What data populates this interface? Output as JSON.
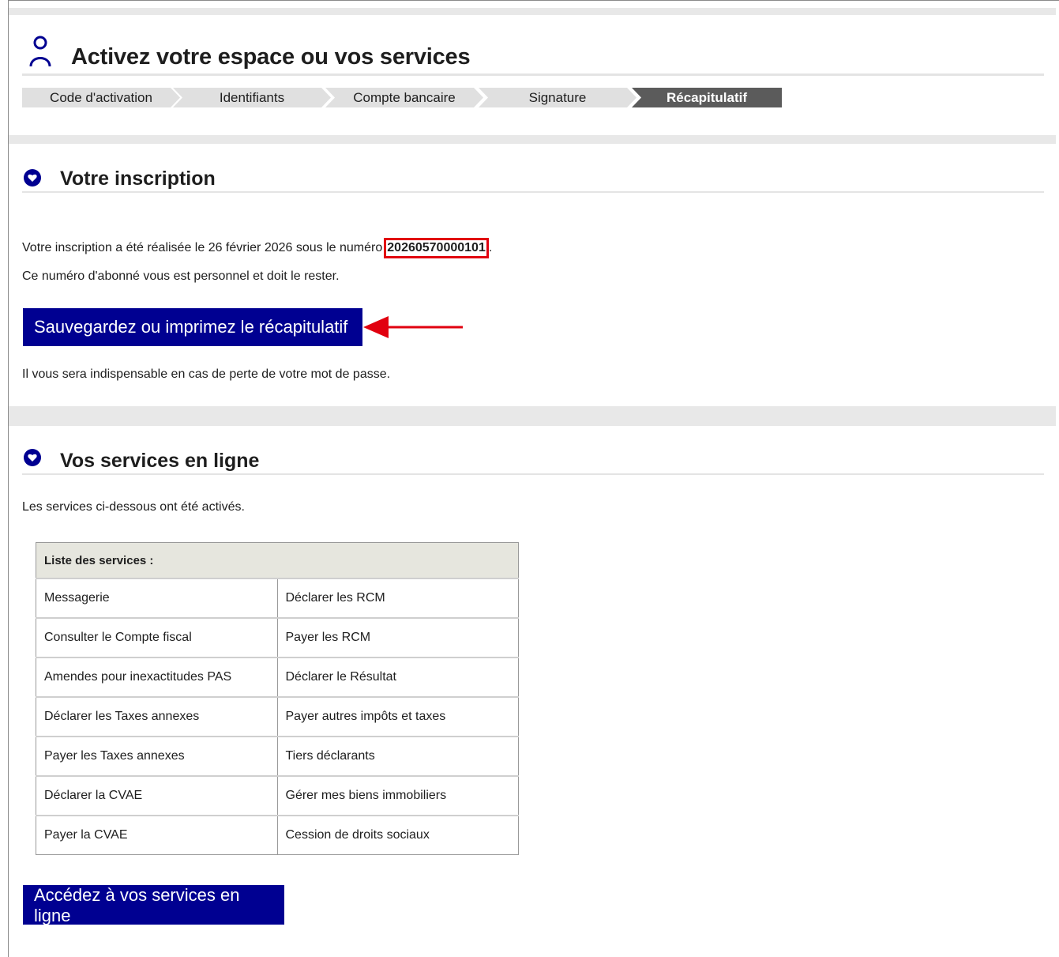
{
  "header": {
    "title": "Activez votre espace ou vos services"
  },
  "stepper": {
    "steps": [
      "Code d'activation",
      "Identifiants",
      "Compte bancaire",
      "Signature",
      "Récapitulatif"
    ],
    "active_index": 4
  },
  "inscription": {
    "title": "Votre inscription",
    "line1_prefix": "Votre inscription a été réalisée le 26 février 2026 sous le numéro",
    "number": "20260570000101",
    "line1_suffix": ".",
    "line2": "Ce numéro d'abonné vous est personnel et doit le rester.",
    "button_label": "Sauvegardez ou imprimez le récapitulatif",
    "note": "Il vous sera indispensable en cas de perte de votre mot de passe."
  },
  "services": {
    "title": "Vos services en ligne",
    "intro": "Les services ci-dessous ont été activés.",
    "table_header": "Liste des services :",
    "rows": [
      [
        "Messagerie",
        "Déclarer les RCM"
      ],
      [
        "Consulter le Compte fiscal",
        "Payer les RCM"
      ],
      [
        "Amendes pour inexactitudes PAS",
        "Déclarer le Résultat"
      ],
      [
        "Déclarer les Taxes annexes",
        "Payer autres impôts et taxes"
      ],
      [
        "Payer les Taxes annexes",
        "Tiers déclarants"
      ],
      [
        "Déclarer la CVAE",
        "Gérer mes biens immobiliers"
      ],
      [
        "Payer la CVAE",
        "Cession de droits sociaux"
      ]
    ],
    "button_label": "Accédez à vos services en ligne"
  },
  "colors": {
    "accent": "#000091",
    "highlight": "#e1000f",
    "step_inactive": "#e0e0e0",
    "step_active": "#5b5b5b"
  }
}
